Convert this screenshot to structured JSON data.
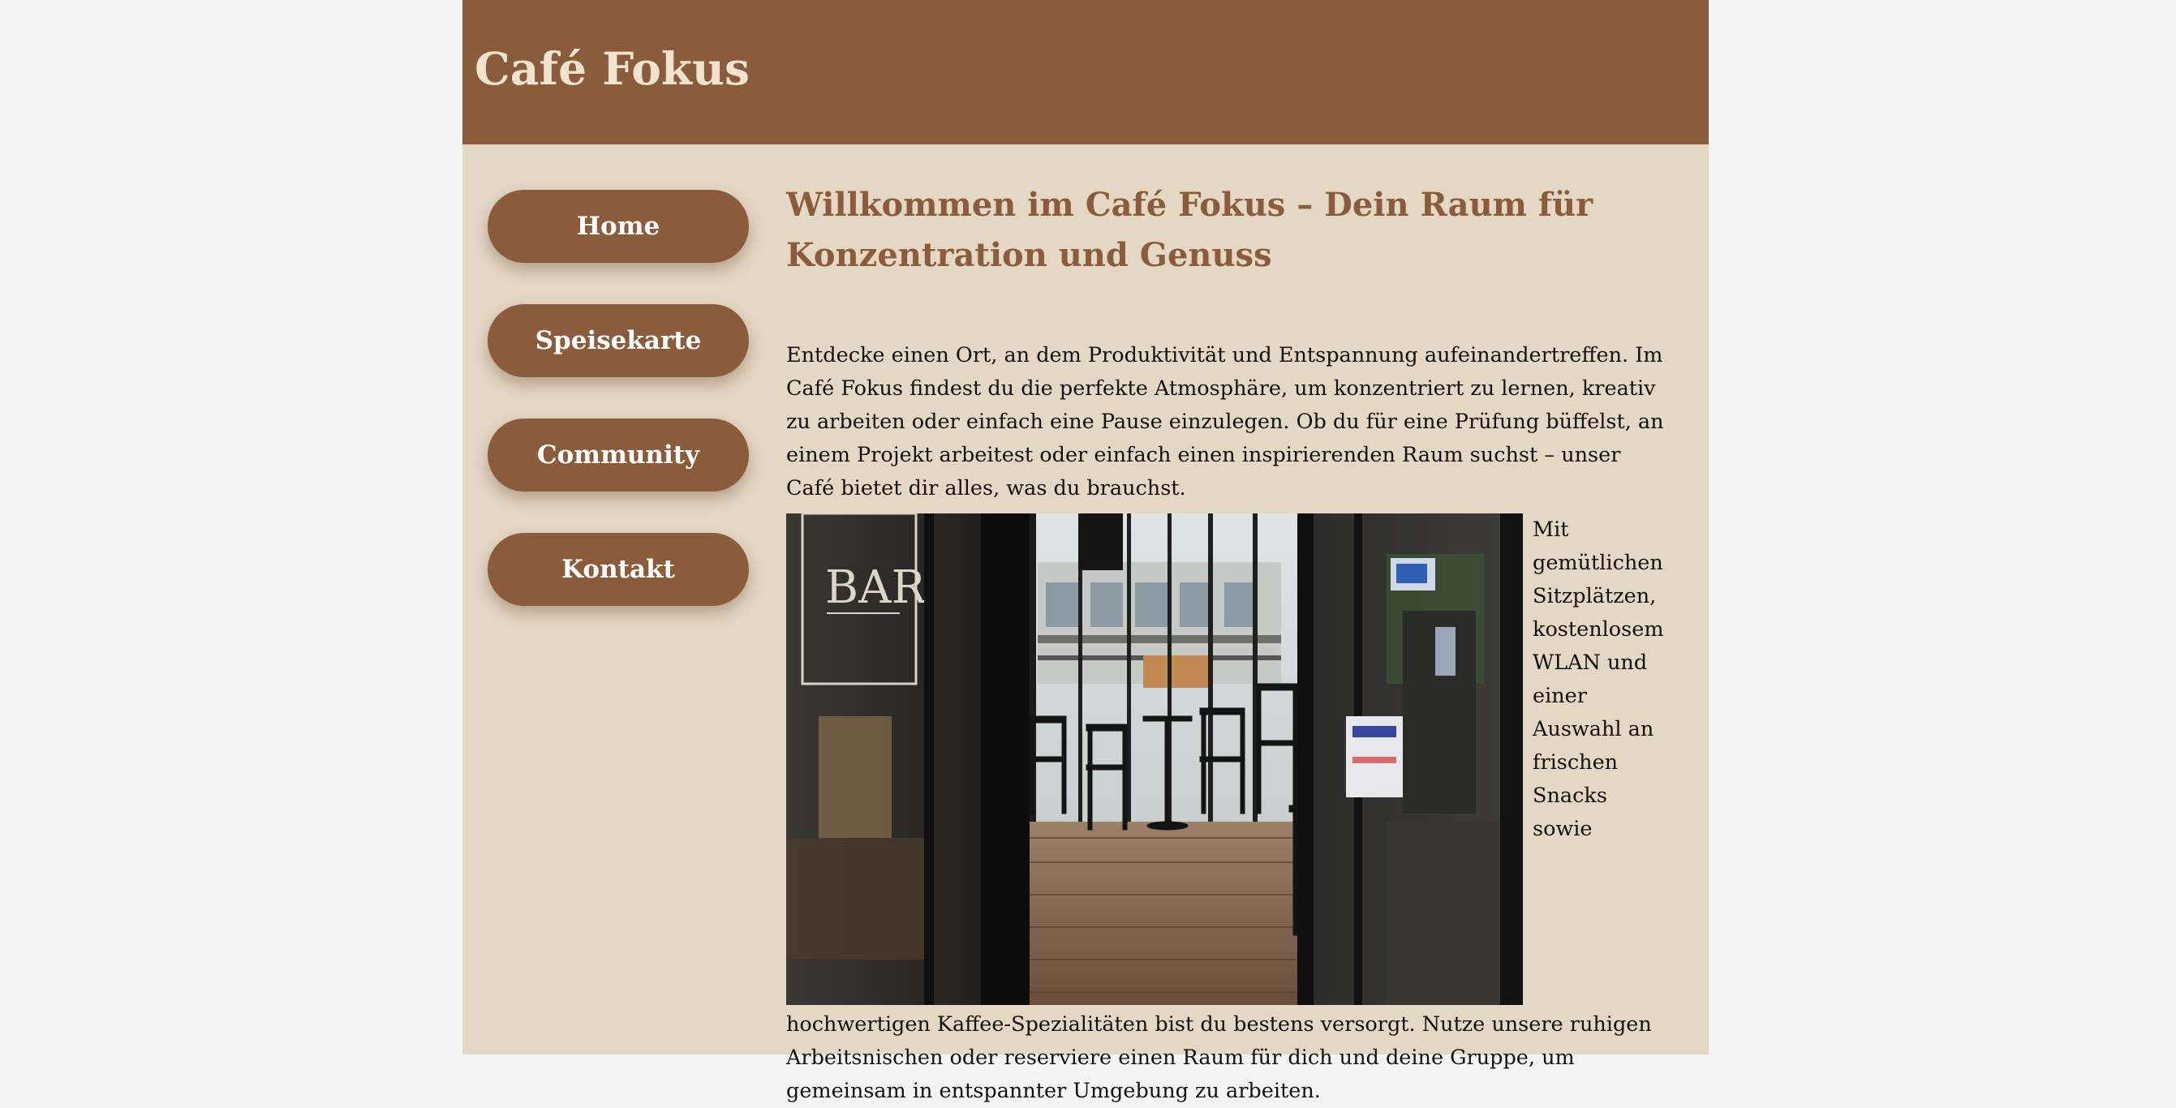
{
  "header": {
    "title": "Café Fokus"
  },
  "nav": {
    "items": [
      {
        "label": "Home"
      },
      {
        "label": "Speisekarte"
      },
      {
        "label": "Community"
      },
      {
        "label": "Kontakt"
      }
    ]
  },
  "main": {
    "headline": "Willkommen im Café Fokus – Dein Raum für Konzentration und Genuss",
    "intro": "Entdecke einen Ort, an dem Produktivität und Entspannung aufeinandertreffen. Im Café Fokus findest du die perfekte Atmosphäre, um konzentriert zu lernen, kreativ zu arbeiten oder einfach eine Pause einzulegen. Ob du für eine Prüfung büffelst, an einem Projekt arbeitest oder einfach einen inspirierenden Raum suchst – unser Café bietet dir alles, was du brauchst.",
    "photo_text": "Mit gemütlichen Sitzplätzen, kostenlosem WLAN und einer Auswahl an frischen Snacks sowie hochwertigen Kaffee-Spezialitäten bist du bestens versorgt. Nutze unsere ruhigen Arbeitsnischen oder reserviere einen Raum für dich und deine Gruppe, um gemeinsam in entspannter Umgebung zu arbeiten.",
    "photo_sign": "BAR"
  },
  "colors": {
    "brand_brown": "#8b5c3b",
    "page_beige": "#e4d7c4",
    "title_cream": "#efe2cf",
    "outer_bg": "#f4f4f5"
  }
}
